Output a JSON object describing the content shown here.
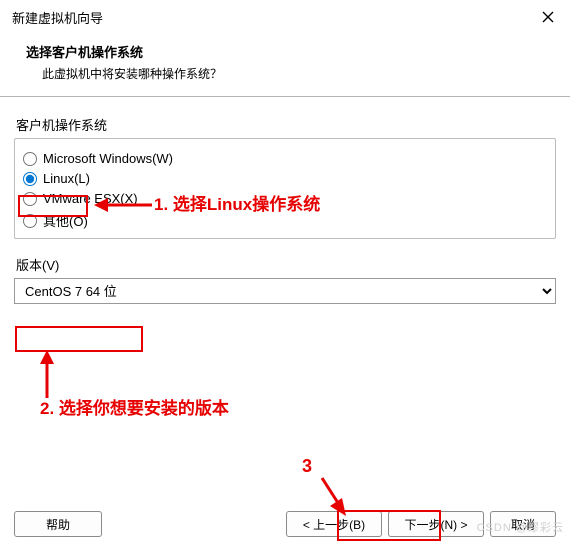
{
  "titlebar": {
    "title": "新建虚拟机向导"
  },
  "header": {
    "title": "选择客户机操作系统",
    "subtitle": "此虚拟机中将安装哪种操作系统？"
  },
  "os_group": {
    "label": "客户机操作系统",
    "options": [
      {
        "label": "Microsoft Windows(W)",
        "checked": false
      },
      {
        "label": "Linux(L)",
        "checked": true
      },
      {
        "label": "VMware ESX(X)",
        "checked": false
      },
      {
        "label": "其他(O)",
        "checked": false
      }
    ]
  },
  "version": {
    "label": "版本(V)",
    "selected": "CentOS 7 64 位"
  },
  "buttons": {
    "help": "帮助",
    "back": "< 上一步(B)",
    "next": "下一步(N) >",
    "cancel": "取消"
  },
  "annotations": {
    "step1": "1. 选择Linux操作系统",
    "step2": "2. 选择你想要安装的版本",
    "step3": "3"
  },
  "watermark": "CSDN @缪彩云"
}
